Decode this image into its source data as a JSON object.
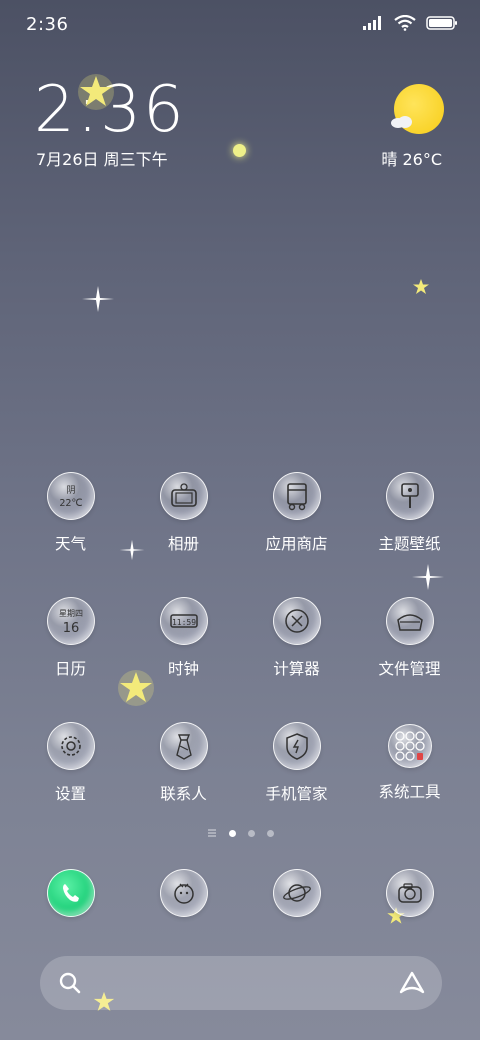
{
  "status_bar": {
    "time": "2:36",
    "battery_level": 1.0
  },
  "widget": {
    "clock": "2:36",
    "date": "7月26日 周三下午",
    "weather": "晴 26°C"
  },
  "apps": [
    {
      "label": "天气",
      "icon": "weather-icon",
      "icon_text": "阴",
      "icon_text2": "22℃"
    },
    {
      "label": "相册",
      "icon": "gallery-icon"
    },
    {
      "label": "应用商店",
      "icon": "app-store-icon"
    },
    {
      "label": "主题壁纸",
      "icon": "themes-icon"
    },
    {
      "label": "日历",
      "icon": "calendar-icon",
      "icon_text": "星期四",
      "icon_text2": "16"
    },
    {
      "label": "时钟",
      "icon": "clock-icon",
      "icon_text": "11:59"
    },
    {
      "label": "计算器",
      "icon": "calculator-icon"
    },
    {
      "label": "文件管理",
      "icon": "file-manager-icon"
    },
    {
      "label": "设置",
      "icon": "settings-icon"
    },
    {
      "label": "联系人",
      "icon": "contacts-icon"
    },
    {
      "label": "手机管家",
      "icon": "security-icon"
    },
    {
      "label": "系统工具",
      "icon": "system-tools-folder-icon"
    }
  ],
  "page_indicator": {
    "pages": 3,
    "current": 1
  },
  "dock": [
    {
      "icon": "phone-icon"
    },
    {
      "icon": "messages-icon"
    },
    {
      "icon": "browser-icon"
    },
    {
      "icon": "camera-icon"
    }
  ],
  "search": {
    "search_icon": "search-icon",
    "assistant_icon": "assistant-icon"
  },
  "colors": {
    "accent_sun": "#f7cd18",
    "phone_green": "#1fd07a",
    "star": "#f3ea7a"
  }
}
